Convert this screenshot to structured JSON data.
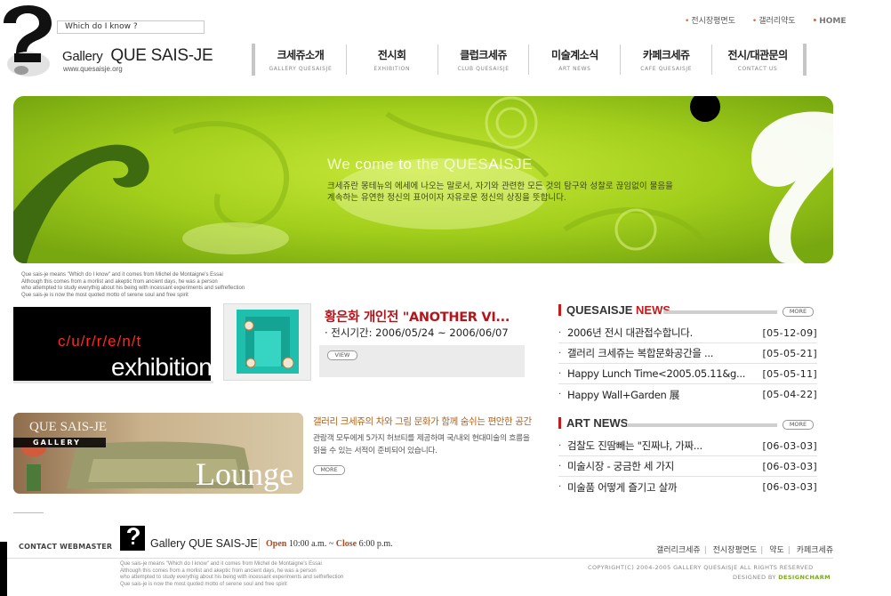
{
  "header": {
    "search_placeholder": "Which do I know ?",
    "brand_small": "Gallery",
    "brand_name": "QUE SAIS-JE",
    "brand_url": "www.quesaisje.org",
    "util_links": [
      "전시장평면도",
      "갤러리약도"
    ],
    "home_label": "HOME"
  },
  "nav": [
    {
      "ko": "크세쥬소개",
      "en": "GALLERY QUESAISJE"
    },
    {
      "ko": "전시회",
      "en": "EXHIBITION"
    },
    {
      "ko": "클럽크세쥬",
      "en": "CLUB QUESAISJE"
    },
    {
      "ko": "미술계소식",
      "en": "ART NEWS"
    },
    {
      "ko": "카페크세쥬",
      "en": "CAFE QUESAISJE"
    },
    {
      "ko": "전시/대관문의",
      "en": "CONTACT US"
    }
  ],
  "hero": {
    "welcome_pre": "We ",
    "welcome_co": "co",
    "welcome_me": "me ",
    "welcome_to": "to ",
    "welcome_the": "the QUES",
    "welcome_a": "A",
    "welcome_isje": "ISJE",
    "description": "크세쥬란 몽테뉴의 에세에 나오는 말로서, 자기와 관련한 모든 것의 탐구와 성찰로 끊임없이 물음을 계속하는 유연한 정신의 표어이자 자유로운 정신의 상징을 뜻합니다."
  },
  "quote_lines": [
    "Que sais-je means \"Which do I know\" and it comes from Michel de Montaigne's Essai",
    "Although this comes from a morlist and akeptic from ancient days, he was a person",
    "who attempted to study everythig about his being with incessant experiments and selfreflection",
    "Que sais-je is now the most quoted motto of serene soul and free spirit"
  ],
  "exhibition": {
    "current_label": "c/u/r/r/e/n/t",
    "exhibition_label": "exhibition",
    "title": "황은화 개인전 \"ANOTHER VI...",
    "period": "· 전시기간: 2006/05/24 ~ 2006/06/07",
    "view_label": "VIEW"
  },
  "lounge": {
    "brand": "QUE SAIS-JE",
    "gallery_label": "GALLERY",
    "lounge_label": "Lounge",
    "title": "갤러리 크세쥬의 차와 그림 문화가 함께 숨쉬는 편안한 공간",
    "description": "관람객 모두에게 5가지 허브티를 제공하며 국/내외 현대미술의 흐름을 읽을 수 있는 서적이 준비되어 있습니다.",
    "more_label": "MORE"
  },
  "news": {
    "title_a": "QUESAISJE",
    "title_b": "NEWS",
    "more_label": "MORE",
    "items": [
      {
        "title": "2006년 전시 대관접수합니다.",
        "date": "[05-12-09]"
      },
      {
        "title": "갤러리 크세쥬는 복합문화공간을 ...",
        "date": "[05-05-21]"
      },
      {
        "title": "Happy Lunch Time<2005.05.11&g...",
        "date": "[05-05-11]"
      },
      {
        "title": "Happy Wall+Garden 展",
        "date": "[05-04-22]"
      }
    ]
  },
  "artnews": {
    "title": "ART NEWS",
    "more_label": "MORE",
    "items": [
      {
        "title": "검찰도 진땀빼는 \"진짜냐, 가짜...",
        "date": "[06-03-03]"
      },
      {
        "title": "미술시장 - 궁금한 세 가지",
        "date": "[06-03-03]"
      },
      {
        "title": "미술품 어떻게 즐기고 살까",
        "date": "[06-03-03]"
      }
    ]
  },
  "footer": {
    "contact": "CONTACT WEBMASTER",
    "brand": "Gallery QUE SAIS-JE",
    "open_label": "Open",
    "open_time": "10:00 a.m. ~",
    "close_label": "Close",
    "close_time": "6:00 p.m.",
    "links": [
      "갤러리크세쥬",
      "전시장평면도",
      "약도",
      "카페크세쥬"
    ],
    "copyright": "COPYRIGHT(C) 2004-2005 GALLERY QUESAISJE ALL RIGHTS RESERVED",
    "designed_by": "DESIGNED BY",
    "designer": "DESIGNCHARM"
  },
  "colors": {
    "accent_red": "#c41a1a",
    "hero_green": "#a8d21a",
    "dark_green": "#3e6b10",
    "designer_green": "#7ba81c"
  }
}
